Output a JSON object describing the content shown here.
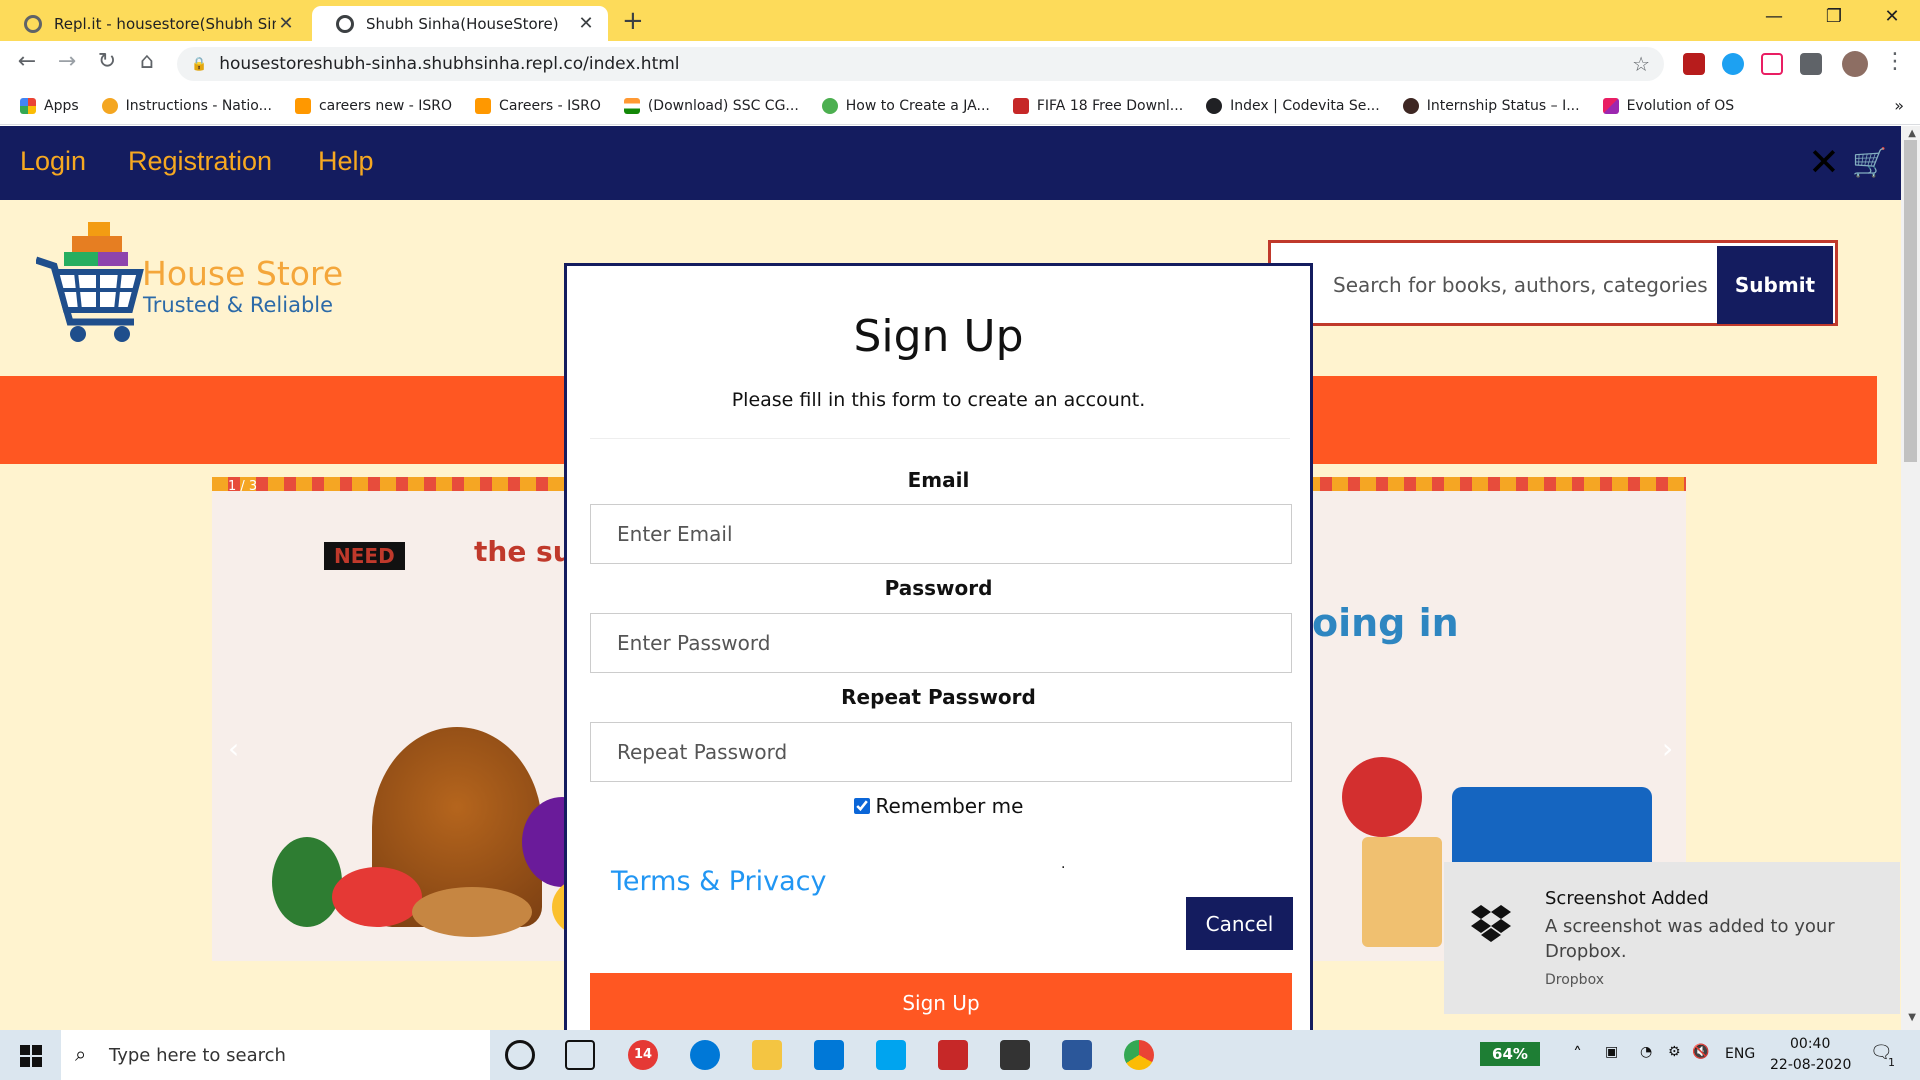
{
  "browser": {
    "tabs": [
      {
        "title": "Repl.it - housestore(Shubh Sinha)",
        "active": false
      },
      {
        "title": "Shubh Sinha(HouseStore)",
        "active": true
      }
    ],
    "url": "housestoreshubh-sinha.shubhsinha.repl.co/index.html",
    "bookmarks": [
      "Apps",
      "Instructions - Natio...",
      "careers new - ISRO",
      "Careers - ISRO",
      "(Download) SSC CG...",
      "How to Create a JA...",
      "FIFA 18 Free Downl...",
      "Index | Codevita Se...",
      "Internship Status – I...",
      "Evolution of OS"
    ]
  },
  "navbar": {
    "links": [
      "Login",
      "Registration",
      "Help"
    ],
    "close_glyph": "✕",
    "cart_icon": "cart-icon"
  },
  "header": {
    "logo_title": "House Store",
    "logo_tagline": "Trusted & Reliable",
    "search_placeholder": "Search for books, authors, categories",
    "search_button": "Submit"
  },
  "slideshow": {
    "slide_number": "1 / 3",
    "banner_brand": "NEED",
    "banner_text": "the sup",
    "banner_right": "oing in",
    "prev": "‹",
    "next": "›"
  },
  "modal": {
    "title": "Sign Up",
    "subtitle": "Please fill in this form to create an account.",
    "email_label": "Email",
    "email_placeholder": "Enter Email",
    "password_label": "Password",
    "password_placeholder": "Enter Password",
    "repeat_label": "Repeat Password",
    "repeat_placeholder": "Repeat Password",
    "remember_label": "Remember me",
    "remember_checked": true,
    "terms_link": "Terms & Privacy",
    "cancel_button": "Cancel",
    "signup_button": "Sign Up"
  },
  "toast": {
    "title": "Screenshot Added",
    "body": "A screenshot was added to your Dropbox.",
    "source": "Dropbox"
  },
  "taskbar": {
    "search_placeholder": "Type here to search",
    "battery": "64%",
    "language": "ENG",
    "time": "00:40",
    "date": "22-08-2020",
    "notification_count": "1",
    "badge_count": "14"
  },
  "colors": {
    "navbar": "#141c5f",
    "accent_orange": "#ff5722",
    "page_bg": "#fff3cf",
    "link_gold": "#f6a821",
    "tabstrip": "#fddb5a"
  }
}
